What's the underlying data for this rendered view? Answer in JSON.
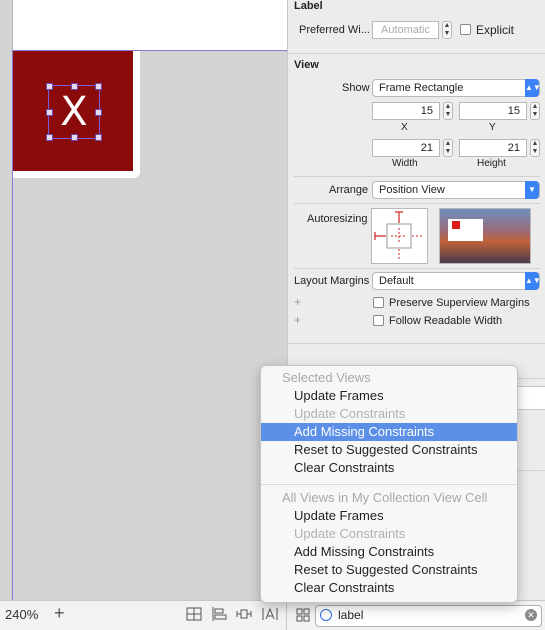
{
  "canvas": {
    "cell_label": "X"
  },
  "bottom_bar": {
    "zoom": "240%",
    "add_label": "+",
    "filter_value": "label"
  },
  "inspector": {
    "label_section": {
      "title": "Label",
      "preferred_width_label": "Preferred Wi...",
      "preferred_width_placeholder": "Automatic",
      "explicit_label": "Explicit"
    },
    "view_section": {
      "title": "View",
      "show_label": "Show",
      "show_value": "Frame Rectangle",
      "x_value": "15",
      "y_value": "15",
      "x_label": "X",
      "y_label": "Y",
      "width_value": "21",
      "height_value": "21",
      "width_label": "Width",
      "height_label": "Height",
      "arrange_label": "Arrange",
      "arrange_value": "Position View",
      "autoresizing_label": "Autoresizing",
      "layout_margins_label": "Layout Margins",
      "layout_margins_value": "Default",
      "preserve_label": "Preserve Superview Margins",
      "follow_label": "Follow Readable Width"
    }
  },
  "menu": {
    "selected_header": "Selected Views",
    "selected_items": [
      {
        "label": "Update Frames",
        "state": "enabled"
      },
      {
        "label": "Update Constraints",
        "state": "disabled"
      },
      {
        "label": "Add Missing Constraints",
        "state": "highlighted"
      },
      {
        "label": "Reset to Suggested Constraints",
        "state": "enabled"
      },
      {
        "label": "Clear Constraints",
        "state": "enabled"
      }
    ],
    "all_header": "All Views in My Collection View Cell",
    "all_items": [
      {
        "label": "Update Frames",
        "state": "enabled"
      },
      {
        "label": "Update Constraints",
        "state": "disabled"
      },
      {
        "label": "Add Missing Constraints",
        "state": "enabled"
      },
      {
        "label": "Reset to Suggested Constraints",
        "state": "enabled"
      },
      {
        "label": "Clear Constraints",
        "state": "enabled"
      }
    ]
  },
  "colors": {
    "cell_red": "#8b0b0b",
    "highlight": "#5b8fe8",
    "accent_blue": "#3b82f6"
  }
}
